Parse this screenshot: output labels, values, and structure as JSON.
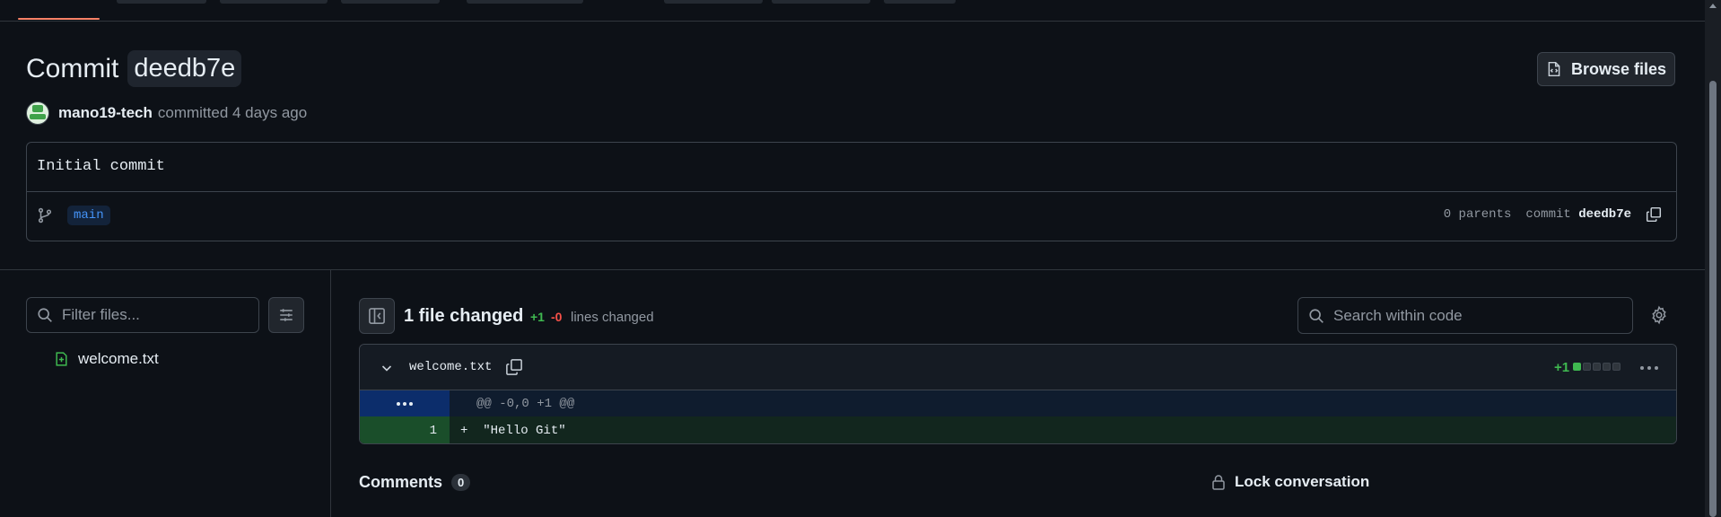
{
  "commit": {
    "title_prefix": "Commit",
    "sha_short": "deedb7e",
    "author": "mano19-tech",
    "committed_text": "committed 4 days ago",
    "message": "Initial commit",
    "branch": "main",
    "parents_label": "0 parents",
    "commit_label": "commit",
    "browse_files_label": "Browse files"
  },
  "file_tree": {
    "filter_placeholder": "Filter files...",
    "files": [
      {
        "name": "welcome.txt",
        "status": "added"
      }
    ]
  },
  "diff_summary": {
    "files_changed": "1 file changed",
    "additions": "+1",
    "deletions": "-0",
    "lines_changed_label": "lines changed",
    "search_placeholder": "Search within code"
  },
  "diff_file": {
    "filename": "welcome.txt",
    "additions_label": "+1",
    "diffstat": [
      "added",
      "neutral",
      "neutral",
      "neutral",
      "neutral"
    ],
    "hunk_header": "@@ -0,0 +1 @@",
    "lines": [
      {
        "number": "1",
        "marker": "+",
        "text": "\"Hello Git\""
      }
    ]
  },
  "comments": {
    "label": "Comments",
    "count": "0",
    "lock_label": "Lock conversation"
  },
  "icons": [
    "file-code-icon",
    "git-branch-icon",
    "copy-icon",
    "search-icon",
    "sliders-icon",
    "file-added-icon",
    "sidebar-collapse-icon",
    "gear-icon",
    "chevron-down-icon",
    "kebab-icon",
    "lock-icon"
  ],
  "colors": {
    "background": "#0d1117",
    "addition": "#3fb950",
    "deletion": "#f85149",
    "link": "#4493f8"
  }
}
